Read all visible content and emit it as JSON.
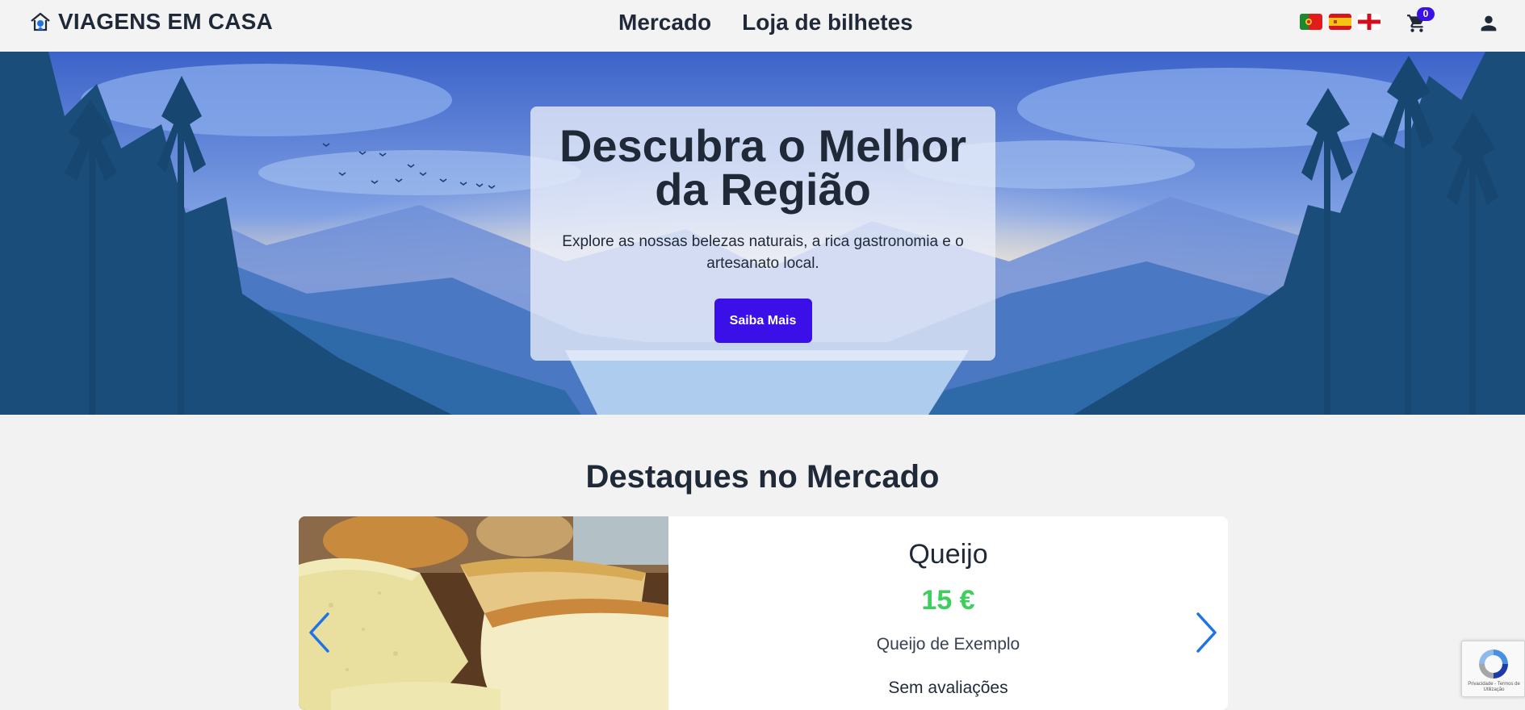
{
  "header": {
    "brand": "VIAGENS EM CASA",
    "nav": [
      {
        "label": "Mercado"
      },
      {
        "label": "Loja de bilhetes"
      }
    ],
    "languages": [
      "pt",
      "es",
      "en"
    ],
    "cart_count": "0",
    "icons": {
      "logo": "house-pin-icon",
      "cart": "cart-icon",
      "user": "user-icon"
    }
  },
  "hero": {
    "title": "Descubra o Melhor da Região",
    "subtitle": "Explore as nossas belezas naturais, a rica gastronomia e o artesanato local.",
    "cta_label": "Saiba Mais"
  },
  "highlights": {
    "title": "Destaques no Mercado",
    "product": {
      "name": "Queijo",
      "price": "15 €",
      "description": "Queijo de Exemplo",
      "rating_text": "Sem avaliações"
    }
  },
  "recaptcha": {
    "text": "Privacidade - Termos de Utilização"
  },
  "colors": {
    "accent": "#3b10e8",
    "price": "#3ccf5b",
    "arrow": "#1e73e8",
    "text": "#1f2937"
  }
}
